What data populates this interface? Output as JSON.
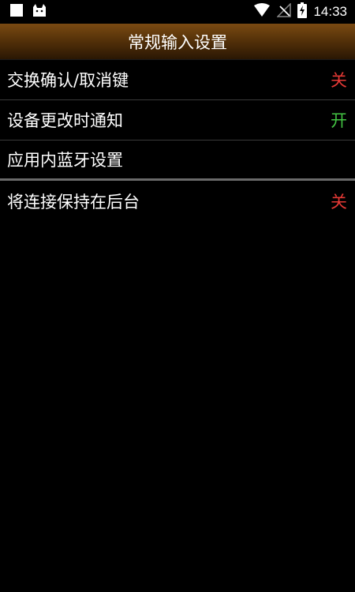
{
  "status_bar": {
    "time": "14:33",
    "icons": [
      "square-notification-icon",
      "cat-app-icon",
      "wifi-icon",
      "no-signal-icon",
      "battery-charging-icon"
    ]
  },
  "header": {
    "title": "常规输入设置"
  },
  "settings": [
    {
      "label": "交换确认/取消键",
      "value": "关",
      "state": "off"
    },
    {
      "label": "设备更改时通知",
      "value": "开",
      "state": "on"
    },
    {
      "label": "应用内蓝牙设置",
      "value": "",
      "state": "none"
    },
    {
      "label": "将连接保持在后台",
      "value": "关",
      "state": "off"
    }
  ],
  "colors": {
    "off": "#e53935",
    "on": "#43c443",
    "header_brown": "#5a340a"
  }
}
